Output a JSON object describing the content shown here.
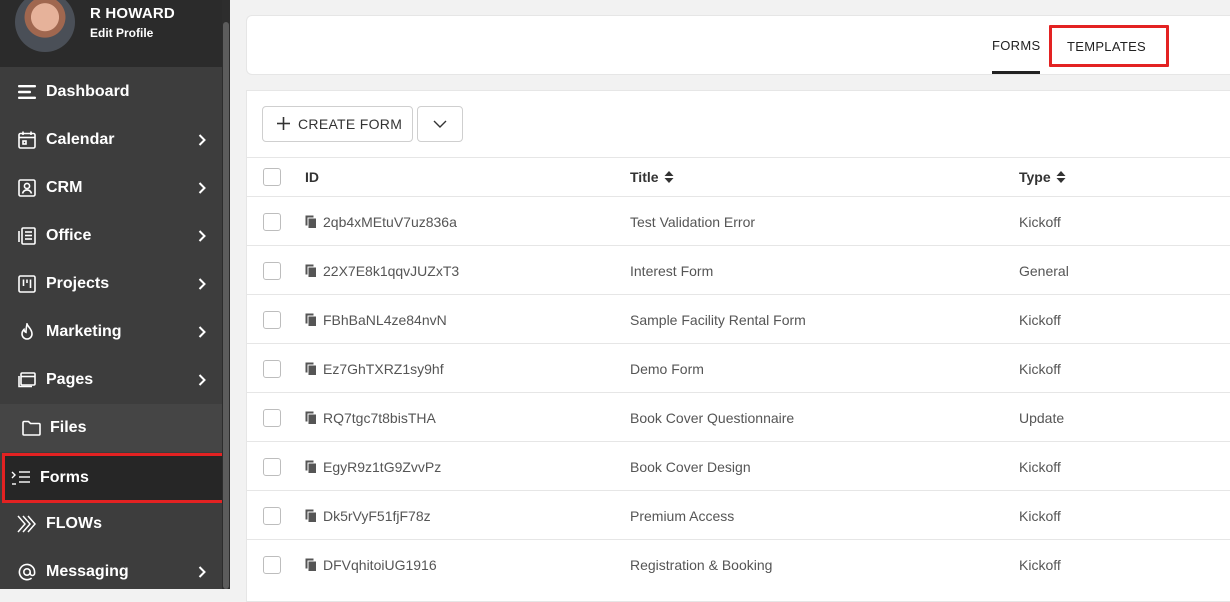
{
  "profile": {
    "name": "R HOWARD",
    "edit_label": "Edit Profile"
  },
  "sidebar": {
    "items": [
      {
        "label": "Dashboard",
        "icon": "hamburger-icon",
        "has_chevron": false
      },
      {
        "label": "Calendar",
        "icon": "calendar-icon",
        "has_chevron": true
      },
      {
        "label": "CRM",
        "icon": "contact-card-icon",
        "has_chevron": true
      },
      {
        "label": "Office",
        "icon": "office-icon",
        "has_chevron": true
      },
      {
        "label": "Projects",
        "icon": "kanban-icon",
        "has_chevron": true
      },
      {
        "label": "Marketing",
        "icon": "flame-icon",
        "has_chevron": true
      },
      {
        "label": "Pages",
        "icon": "pages-icon",
        "has_chevron": true
      },
      {
        "label": "Files",
        "icon": "folder-icon",
        "has_chevron": false
      },
      {
        "label": "Forms",
        "icon": "form-list-icon",
        "has_chevron": false,
        "active": true
      },
      {
        "label": "FLOWs",
        "icon": "flows-chevrons-icon",
        "has_chevron": false
      },
      {
        "label": "Messaging",
        "icon": "at-sign-icon",
        "has_chevron": true
      }
    ]
  },
  "tabs": {
    "forms": "FORMS",
    "templates": "TEMPLATES"
  },
  "toolbar": {
    "create_label": "CREATE FORM"
  },
  "table": {
    "headers": {
      "id": "ID",
      "title": "Title",
      "type": "Type"
    },
    "rows": [
      {
        "id": "2qb4xMEtuV7uz836a",
        "title": "Test Validation Error",
        "type": "Kickoff"
      },
      {
        "id": "22X7E8k1qqvJUZxT3",
        "title": "Interest Form",
        "type": "General"
      },
      {
        "id": "FBhBaNL4ze84nvN",
        "title": "Sample Facility Rental Form",
        "type": "Kickoff"
      },
      {
        "id": "Ez7GhTXRZ1sy9hf",
        "title": "Demo Form",
        "type": "Kickoff"
      },
      {
        "id": "RQ7tgc7t8bisTHA",
        "title": "Book Cover Questionnaire",
        "type": "Update"
      },
      {
        "id": "EgyR9z1tG9ZvvPz",
        "title": "Book Cover Design",
        "type": "Kickoff"
      },
      {
        "id": "Dk5rVyF51fjF78z",
        "title": "Premium Access",
        "type": "Kickoff"
      },
      {
        "id": "DFVqhitoiUG1916",
        "title": "Registration & Booking",
        "type": "Kickoff"
      }
    ]
  },
  "colors": {
    "sidebar_bg": "#3d3d3d",
    "highlight_border": "#e32222",
    "active_item_bg": "#262626"
  }
}
